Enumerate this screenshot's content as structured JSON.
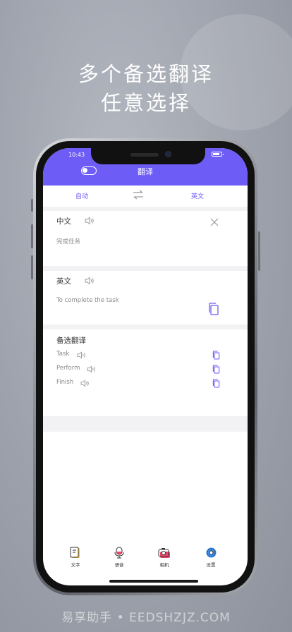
{
  "headline": {
    "line1": "多个备选翻译",
    "line2": "任意选择"
  },
  "status_bar": {
    "time": "10:43"
  },
  "header": {
    "title": "翻译"
  },
  "language_bar": {
    "source": "自动",
    "target": "英文"
  },
  "source_section": {
    "label": "中文",
    "text": "完成任务"
  },
  "target_section": {
    "label": "英文",
    "text": "To complete the task"
  },
  "alternatives": {
    "label": "备选翻译",
    "items": [
      {
        "text": "Task"
      },
      {
        "text": "Perform"
      },
      {
        "text": "Finish"
      }
    ]
  },
  "tabs": [
    {
      "label": "文字",
      "icon": "text-doc-icon"
    },
    {
      "label": "语音",
      "icon": "microphone-icon"
    },
    {
      "label": "相机",
      "icon": "camera-icon"
    },
    {
      "label": "设置",
      "icon": "gear-icon"
    }
  ],
  "watermark": "易享助手 • EEDSHZJZ.COM",
  "colors": {
    "accent": "#6e5cf6",
    "background": "#9ea2ac"
  }
}
